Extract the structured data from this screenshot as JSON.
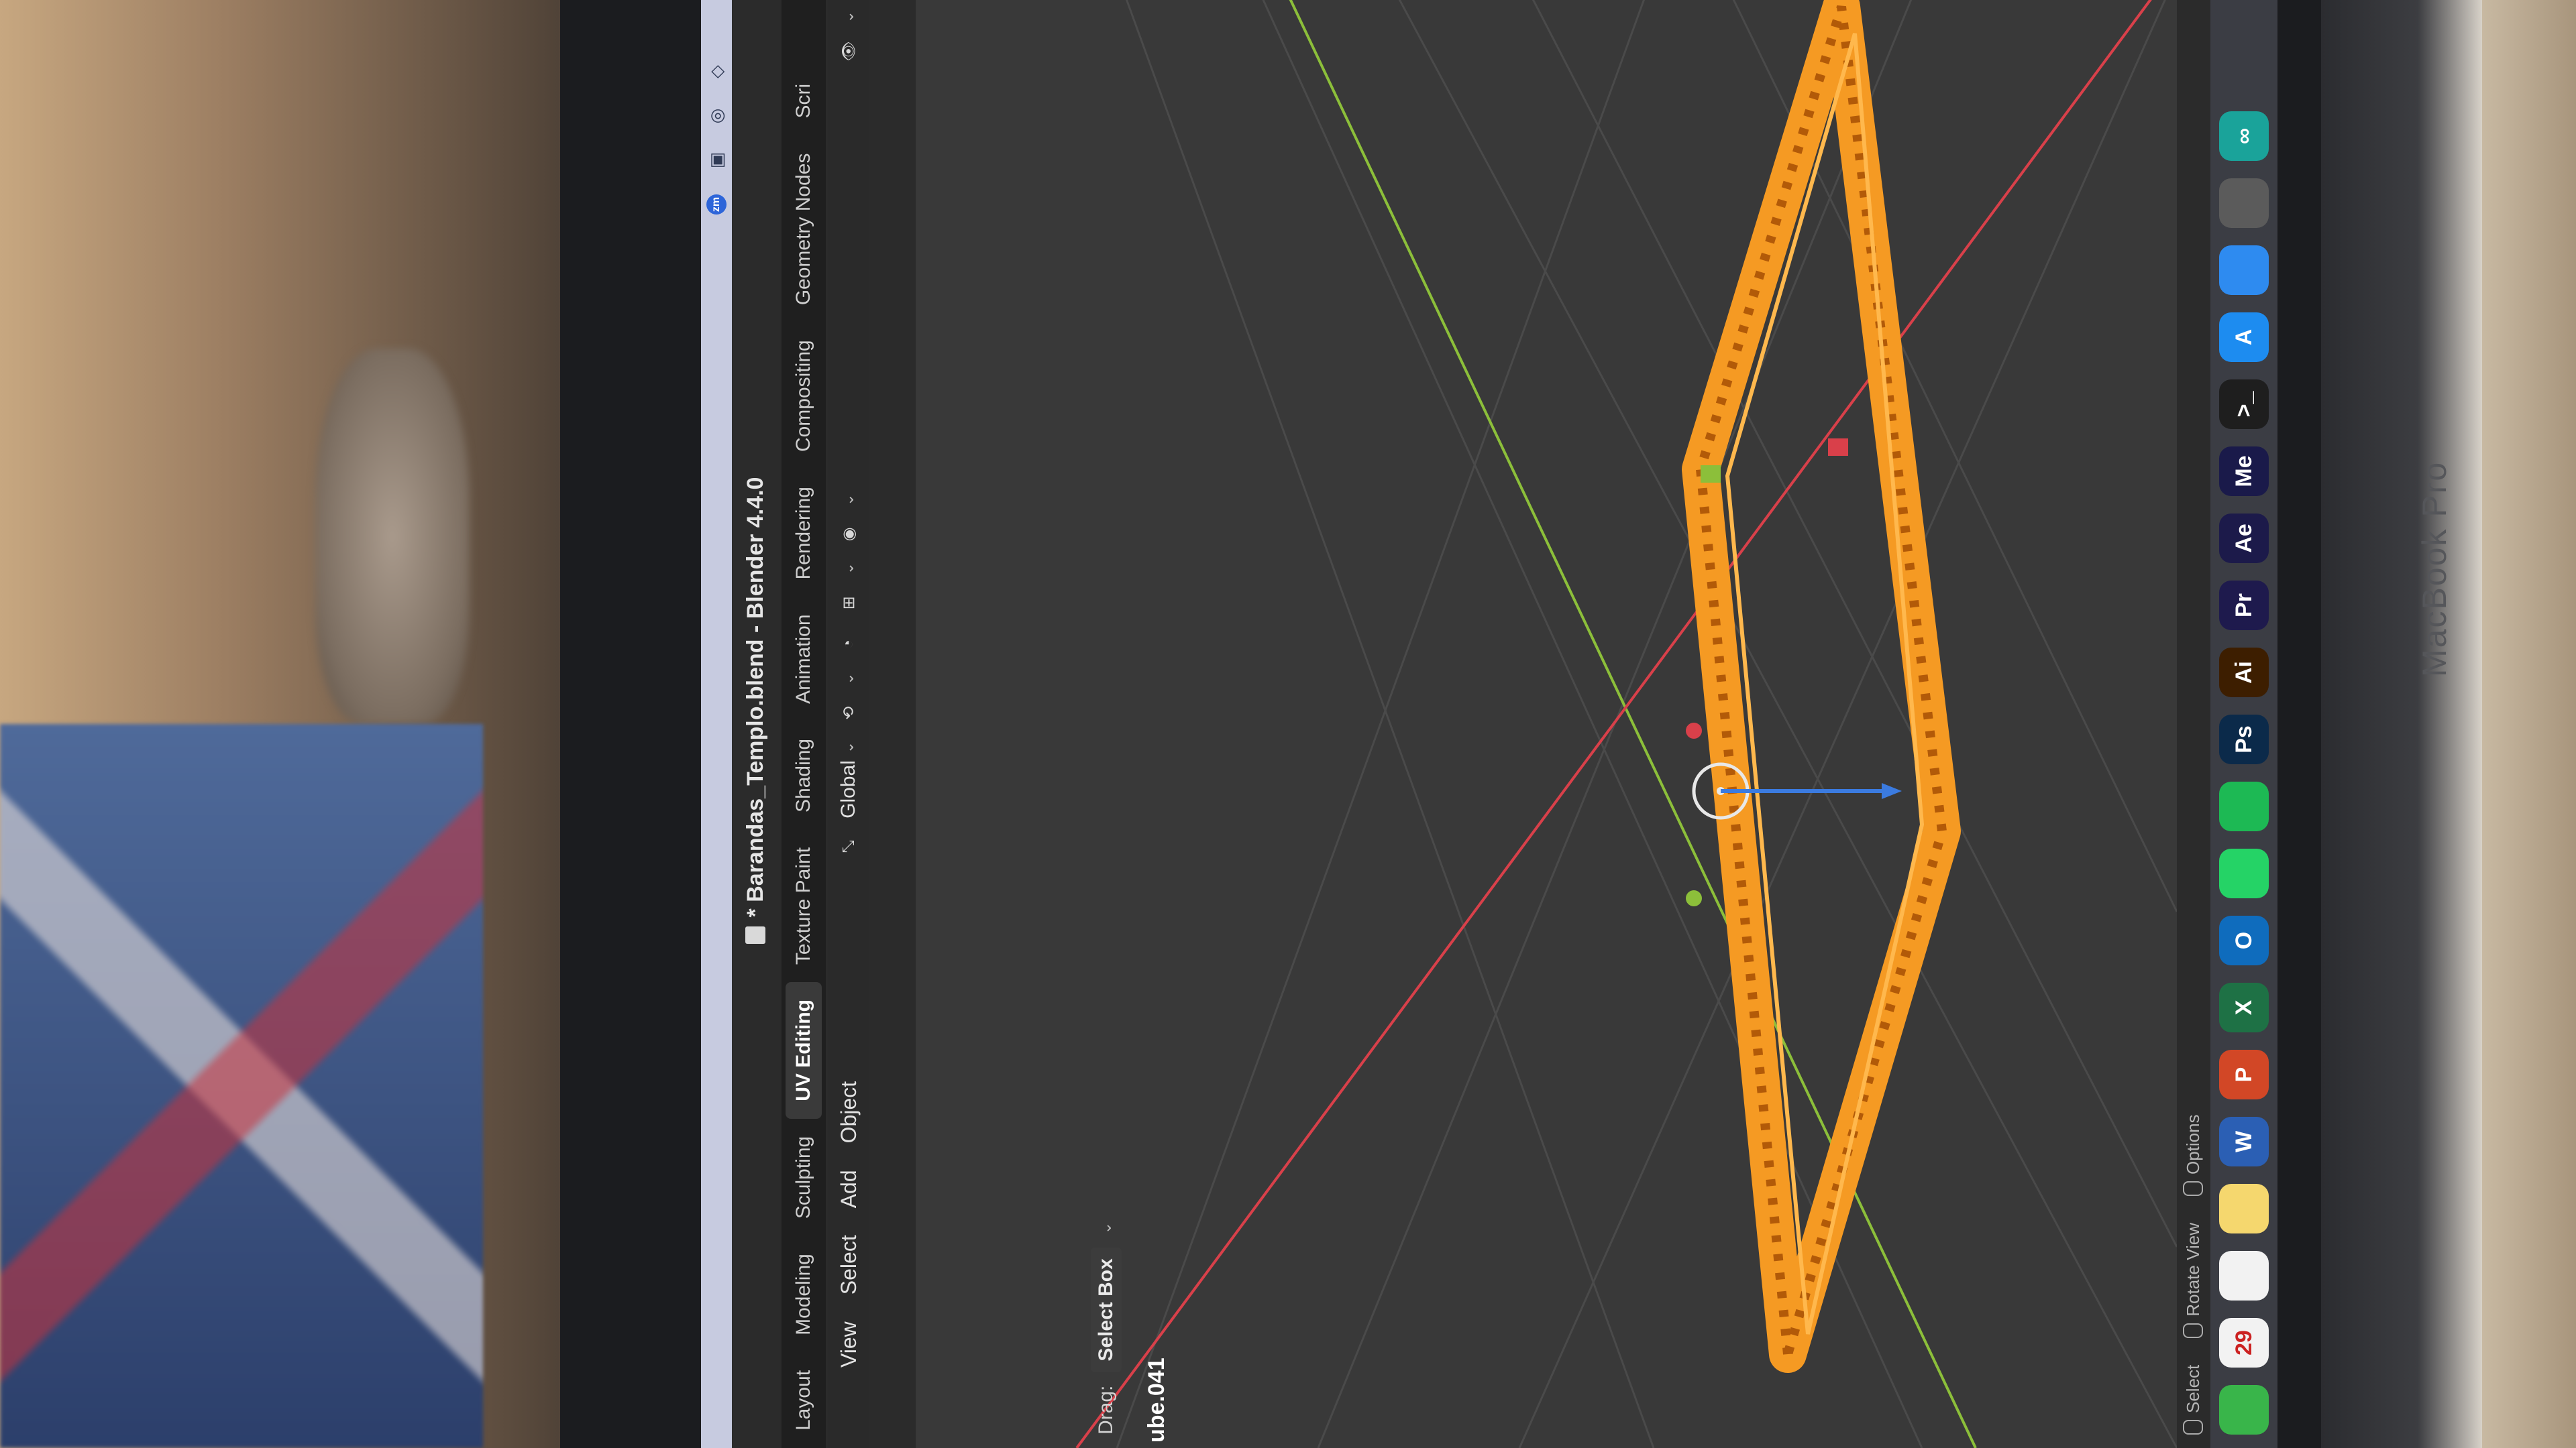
{
  "environment": {
    "bezel_brand": "MacBook Pro"
  },
  "menubar": {
    "icons": [
      "zoom-icon",
      "screenshot-icon",
      "wireless-icon",
      "shield-icon"
    ],
    "zoom_label": "zm"
  },
  "window": {
    "title": "* Barandas_Templo.blend - Blender 4.4.0"
  },
  "workspaces": {
    "tabs": [
      "Layout",
      "Modeling",
      "Sculpting",
      "UV Editing",
      "Texture Paint",
      "Shading",
      "Animation",
      "Rendering",
      "Compositing",
      "Geometry Nodes",
      "Scri"
    ],
    "active": "UV Editing"
  },
  "header": {
    "menus": [
      "View",
      "Select",
      "Add",
      "Object"
    ],
    "orientation": "Global"
  },
  "tool": {
    "drag_label": "Drag:",
    "drag_value": "Select Box"
  },
  "viewport": {
    "object_label": "ube.041",
    "colors": {
      "background": "#393939",
      "selection": "#f59a23",
      "x_axis": "#d9404a",
      "y_axis": "#8cbf3a",
      "z_axis": "#3b7be0"
    }
  },
  "status_bar": {
    "items": [
      "Select",
      "Rotate View",
      "Options"
    ]
  },
  "dock": {
    "apps": [
      {
        "name": "Numbers",
        "label": "",
        "color": "#39b54a"
      },
      {
        "name": "Calendar",
        "label": "29",
        "color": "#f2f2f2"
      },
      {
        "name": "Reminders",
        "label": "",
        "color": "#f2f2f2"
      },
      {
        "name": "Notes",
        "label": "",
        "color": "#f5d76e"
      },
      {
        "name": "Word",
        "label": "W",
        "color": "#2b5fb4"
      },
      {
        "name": "PowerPoint",
        "label": "P",
        "color": "#d24726"
      },
      {
        "name": "Excel",
        "label": "X",
        "color": "#1e7145"
      },
      {
        "name": "Outlook",
        "label": "O",
        "color": "#0f6cbd"
      },
      {
        "name": "WhatsApp",
        "label": "",
        "color": "#25d366"
      },
      {
        "name": "Spotify",
        "label": "",
        "color": "#1db954"
      },
      {
        "name": "Photoshop",
        "label": "Ps",
        "color": "#0b2a4a"
      },
      {
        "name": "Illustrator",
        "label": "Ai",
        "color": "#3d1e00"
      },
      {
        "name": "Premiere Pro",
        "label": "Pr",
        "color": "#1e1a4d"
      },
      {
        "name": "After Effects",
        "label": "Ae",
        "color": "#1c1a4a"
      },
      {
        "name": "Media Encoder",
        "label": "Me",
        "color": "#1a1a4a"
      },
      {
        "name": "Terminal",
        "label": ">_",
        "color": "#1e1e1e"
      },
      {
        "name": "App Store",
        "label": "A",
        "color": "#1d8cf0"
      },
      {
        "name": "Safari",
        "label": "",
        "color": "#2e8bf0"
      },
      {
        "name": "ChatGPT",
        "label": "",
        "color": "#5b5b5b"
      },
      {
        "name": "Copilot",
        "label": "∞",
        "color": "#1aa39a"
      }
    ]
  }
}
